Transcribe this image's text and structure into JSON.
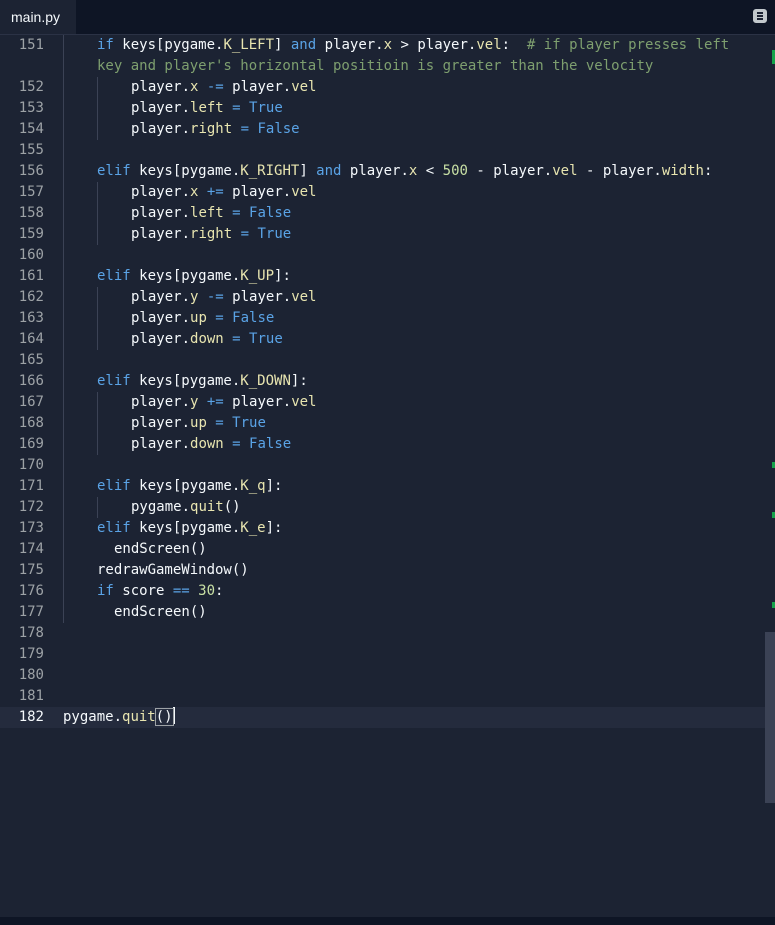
{
  "tab": {
    "filename": "main.py"
  },
  "icons": {
    "tab_menu": "list-icon"
  },
  "editor": {
    "active_line": 182,
    "lines": [
      {
        "n": "151",
        "t": [
          [
            "kw",
            "if"
          ],
          [
            "id",
            " keys[pygame."
          ],
          [
            "prop",
            "K_LEFT"
          ],
          [
            "id",
            "] "
          ],
          [
            "kw",
            "and"
          ],
          [
            "id",
            " player."
          ],
          [
            "prop",
            "x"
          ],
          [
            "id",
            " > player."
          ],
          [
            "prop",
            "vel"
          ],
          [
            "pn",
            ":"
          ],
          [
            "cm",
            "  # if player presses left"
          ]
        ],
        "indent": 1
      },
      {
        "n": "",
        "t": [
          [
            "cm",
            "key and player's horizontal positioin is greater than the velocity"
          ]
        ],
        "indent": 1
      },
      {
        "n": "152",
        "t": [
          [
            "id",
            "player."
          ],
          [
            "prop",
            "x"
          ],
          [
            "op",
            " -= "
          ],
          [
            "id",
            "player."
          ],
          [
            "prop",
            "vel"
          ]
        ],
        "indent": 2
      },
      {
        "n": "153",
        "t": [
          [
            "id",
            "player."
          ],
          [
            "prop",
            "left"
          ],
          [
            "op",
            " = "
          ],
          [
            "bool",
            "True"
          ]
        ],
        "indent": 2
      },
      {
        "n": "154",
        "t": [
          [
            "id",
            "player."
          ],
          [
            "prop",
            "right"
          ],
          [
            "op",
            " = "
          ],
          [
            "bool",
            "False"
          ]
        ],
        "indent": 2
      },
      {
        "n": "155",
        "t": [],
        "indent": 1
      },
      {
        "n": "156",
        "t": [
          [
            "kw",
            "elif"
          ],
          [
            "id",
            " keys[pygame."
          ],
          [
            "prop",
            "K_RIGHT"
          ],
          [
            "id",
            "] "
          ],
          [
            "kw",
            "and"
          ],
          [
            "id",
            " player."
          ],
          [
            "prop",
            "x"
          ],
          [
            "id",
            " < "
          ],
          [
            "num",
            "500"
          ],
          [
            "id",
            " - player."
          ],
          [
            "prop",
            "vel"
          ],
          [
            "id",
            " - player."
          ],
          [
            "prop",
            "width"
          ],
          [
            "pn",
            ":"
          ]
        ],
        "indent": 1
      },
      {
        "n": "157",
        "t": [
          [
            "id",
            "player."
          ],
          [
            "prop",
            "x"
          ],
          [
            "op",
            " += "
          ],
          [
            "id",
            "player."
          ],
          [
            "prop",
            "vel"
          ]
        ],
        "indent": 2
      },
      {
        "n": "158",
        "t": [
          [
            "id",
            "player."
          ],
          [
            "prop",
            "left"
          ],
          [
            "op",
            " = "
          ],
          [
            "bool",
            "False"
          ]
        ],
        "indent": 2
      },
      {
        "n": "159",
        "t": [
          [
            "id",
            "player."
          ],
          [
            "prop",
            "right"
          ],
          [
            "op",
            " = "
          ],
          [
            "bool",
            "True"
          ]
        ],
        "indent": 2
      },
      {
        "n": "160",
        "t": [],
        "indent": 1
      },
      {
        "n": "161",
        "t": [
          [
            "kw",
            "elif"
          ],
          [
            "id",
            " keys[pygame."
          ],
          [
            "prop",
            "K_UP"
          ],
          [
            "id",
            "]"
          ],
          [
            "pn",
            ":"
          ]
        ],
        "indent": 1
      },
      {
        "n": "162",
        "t": [
          [
            "id",
            "player."
          ],
          [
            "prop",
            "y"
          ],
          [
            "op",
            " -= "
          ],
          [
            "id",
            "player."
          ],
          [
            "prop",
            "vel"
          ]
        ],
        "indent": 2
      },
      {
        "n": "163",
        "t": [
          [
            "id",
            "player."
          ],
          [
            "prop",
            "up"
          ],
          [
            "op",
            " = "
          ],
          [
            "bool",
            "False"
          ]
        ],
        "indent": 2
      },
      {
        "n": "164",
        "t": [
          [
            "id",
            "player."
          ],
          [
            "prop",
            "down"
          ],
          [
            "op",
            " = "
          ],
          [
            "bool",
            "True"
          ]
        ],
        "indent": 2
      },
      {
        "n": "165",
        "t": [],
        "indent": 1
      },
      {
        "n": "166",
        "t": [
          [
            "kw",
            "elif"
          ],
          [
            "id",
            " keys[pygame."
          ],
          [
            "prop",
            "K_DOWN"
          ],
          [
            "id",
            "]"
          ],
          [
            "pn",
            ":"
          ]
        ],
        "indent": 1
      },
      {
        "n": "167",
        "t": [
          [
            "id",
            "player."
          ],
          [
            "prop",
            "y"
          ],
          [
            "op",
            " += "
          ],
          [
            "id",
            "player."
          ],
          [
            "prop",
            "vel"
          ]
        ],
        "indent": 2
      },
      {
        "n": "168",
        "t": [
          [
            "id",
            "player."
          ],
          [
            "prop",
            "up"
          ],
          [
            "op",
            " = "
          ],
          [
            "bool",
            "True"
          ]
        ],
        "indent": 2
      },
      {
        "n": "169",
        "t": [
          [
            "id",
            "player."
          ],
          [
            "prop",
            "down"
          ],
          [
            "op",
            " = "
          ],
          [
            "bool",
            "False"
          ]
        ],
        "indent": 2
      },
      {
        "n": "170",
        "t": [],
        "indent": 1
      },
      {
        "n": "171",
        "t": [
          [
            "kw",
            "elif"
          ],
          [
            "id",
            " keys[pygame."
          ],
          [
            "prop",
            "K_q"
          ],
          [
            "id",
            "]"
          ],
          [
            "pn",
            ":"
          ]
        ],
        "indent": 1
      },
      {
        "n": "172",
        "t": [
          [
            "id",
            "pygame."
          ],
          [
            "prop",
            "quit"
          ],
          [
            "id",
            "()"
          ]
        ],
        "indent": 2
      },
      {
        "n": "173",
        "t": [
          [
            "kw",
            "elif"
          ],
          [
            "id",
            " keys[pygame."
          ],
          [
            "prop",
            "K_e"
          ],
          [
            "id",
            "]"
          ],
          [
            "pn",
            ":"
          ]
        ],
        "indent": 1
      },
      {
        "n": "174",
        "t": [
          [
            "id",
            "endScreen()"
          ]
        ],
        "indent": 1.5
      },
      {
        "n": "175",
        "t": [
          [
            "id",
            "redrawGameWindow()"
          ]
        ],
        "indent": 1
      },
      {
        "n": "176",
        "t": [
          [
            "kw",
            "if"
          ],
          [
            "id",
            " score "
          ],
          [
            "op",
            "=="
          ],
          [
            "id",
            " "
          ],
          [
            "num",
            "30"
          ],
          [
            "pn",
            ":"
          ]
        ],
        "indent": 1
      },
      {
        "n": "177",
        "t": [
          [
            "id",
            "endScreen()"
          ]
        ],
        "indent": 1.5
      },
      {
        "n": "178",
        "t": [],
        "indent": 0
      },
      {
        "n": "179",
        "t": [],
        "indent": 0
      },
      {
        "n": "180",
        "t": [],
        "indent": 0
      },
      {
        "n": "181",
        "t": [],
        "indent": 0
      },
      {
        "n": "182",
        "t": [
          [
            "id",
            "pygame."
          ],
          [
            "prop",
            "quit"
          ],
          [
            "box",
            "()"
          ]
        ],
        "indent": 0
      }
    ]
  }
}
